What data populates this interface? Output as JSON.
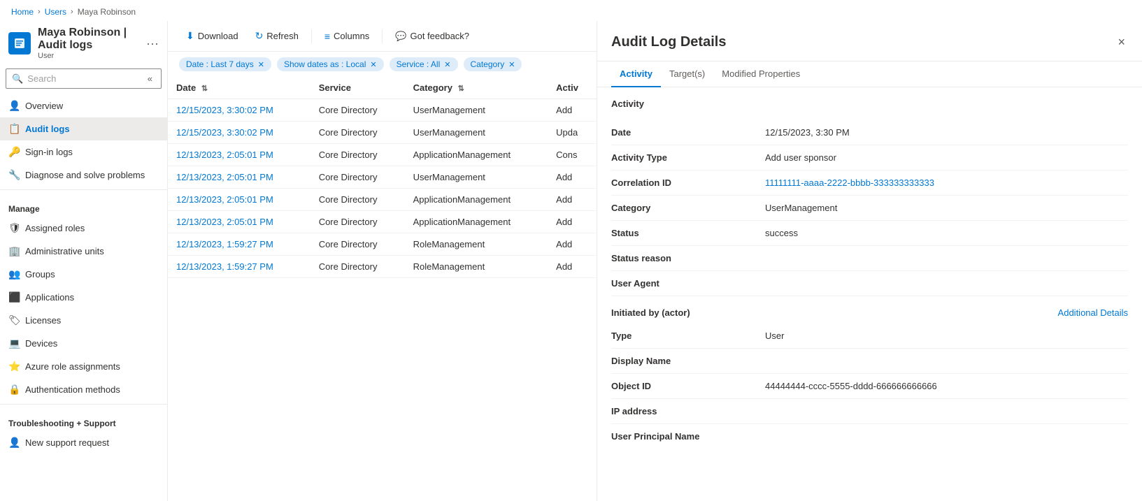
{
  "breadcrumb": {
    "items": [
      "Home",
      "Users",
      "Maya Robinson"
    ],
    "separators": [
      ">",
      ">"
    ]
  },
  "page": {
    "title": "Maya Robinson | Audit logs",
    "subtitle": "User",
    "more_icon": "···"
  },
  "sidebar": {
    "search_placeholder": "Search",
    "collapse_icon": "«",
    "nav_items": [
      {
        "id": "overview",
        "label": "Overview",
        "icon": "👤",
        "active": false
      },
      {
        "id": "audit-logs",
        "label": "Audit logs",
        "icon": "📋",
        "active": true
      },
      {
        "id": "sign-in-logs",
        "label": "Sign-in logs",
        "icon": "🔑",
        "active": false
      },
      {
        "id": "diagnose",
        "label": "Diagnose and solve problems",
        "icon": "🔧",
        "active": false
      }
    ],
    "manage_label": "Manage",
    "manage_items": [
      {
        "id": "assigned-roles",
        "label": "Assigned roles",
        "icon": "🛡"
      },
      {
        "id": "admin-units",
        "label": "Administrative units",
        "icon": "🏢"
      },
      {
        "id": "groups",
        "label": "Groups",
        "icon": "👥"
      },
      {
        "id": "applications",
        "label": "Applications",
        "icon": "⬛"
      },
      {
        "id": "licenses",
        "label": "Licenses",
        "icon": "🏷"
      },
      {
        "id": "devices",
        "label": "Devices",
        "icon": "💻"
      },
      {
        "id": "azure-roles",
        "label": "Azure role assignments",
        "icon": "⭐"
      },
      {
        "id": "auth-methods",
        "label": "Authentication methods",
        "icon": "🔒"
      }
    ],
    "troubleshooting_label": "Troubleshooting + Support",
    "support_items": [
      {
        "id": "new-support",
        "label": "New support request",
        "icon": "👤"
      }
    ]
  },
  "toolbar": {
    "download_label": "Download",
    "refresh_label": "Refresh",
    "columns_label": "Columns",
    "feedback_label": "Got feedback?"
  },
  "filters": {
    "date_filter": "Date : Last 7 days",
    "show_dates_filter": "Show dates as : Local",
    "service_filter": "Service : All",
    "category_filter": "Category"
  },
  "table": {
    "columns": [
      {
        "id": "date",
        "label": "Date",
        "sortable": true
      },
      {
        "id": "service",
        "label": "Service",
        "sortable": false
      },
      {
        "id": "category",
        "label": "Category",
        "sortable": true
      },
      {
        "id": "activity",
        "label": "Activ",
        "sortable": false
      }
    ],
    "rows": [
      {
        "date": "12/15/2023, 3:30:02 PM",
        "service": "Core Directory",
        "category": "UserManagement",
        "activity": "Add"
      },
      {
        "date": "12/15/2023, 3:30:02 PM",
        "service": "Core Directory",
        "category": "UserManagement",
        "activity": "Upda"
      },
      {
        "date": "12/13/2023, 2:05:01 PM",
        "service": "Core Directory",
        "category": "ApplicationManagement",
        "activity": "Cons"
      },
      {
        "date": "12/13/2023, 2:05:01 PM",
        "service": "Core Directory",
        "category": "UserManagement",
        "activity": "Add"
      },
      {
        "date": "12/13/2023, 2:05:01 PM",
        "service": "Core Directory",
        "category": "ApplicationManagement",
        "activity": "Add"
      },
      {
        "date": "12/13/2023, 2:05:01 PM",
        "service": "Core Directory",
        "category": "ApplicationManagement",
        "activity": "Add"
      },
      {
        "date": "12/13/2023, 1:59:27 PM",
        "service": "Core Directory",
        "category": "RoleManagement",
        "activity": "Add"
      },
      {
        "date": "12/13/2023, 1:59:27 PM",
        "service": "Core Directory",
        "category": "RoleManagement",
        "activity": "Add"
      }
    ]
  },
  "detail_panel": {
    "title": "Audit Log Details",
    "close_icon": "×",
    "tabs": [
      {
        "id": "activity",
        "label": "Activity",
        "active": true
      },
      {
        "id": "targets",
        "label": "Target(s)",
        "active": false
      },
      {
        "id": "modified-properties",
        "label": "Modified Properties",
        "active": false
      }
    ],
    "activity_section_title": "Activity",
    "fields": [
      {
        "label": "Date",
        "value": "12/15/2023, 3:30 PM",
        "type": "normal"
      },
      {
        "label": "Activity Type",
        "value": "Add user sponsor",
        "type": "normal"
      },
      {
        "label": "Correlation ID",
        "value": "11111111-aaaa-2222-bbbb-333333333333",
        "type": "link"
      },
      {
        "label": "Category",
        "value": "UserManagement",
        "type": "normal"
      },
      {
        "label": "Status",
        "value": "success",
        "type": "normal"
      },
      {
        "label": "Status reason",
        "value": "",
        "type": "normal"
      },
      {
        "label": "User Agent",
        "value": "",
        "type": "normal"
      }
    ],
    "initiated_by_label": "Initiated by (actor)",
    "additional_details_label": "Additional Details",
    "actor_fields": [
      {
        "label": "Type",
        "value": "User",
        "type": "normal"
      },
      {
        "label": "Display Name",
        "value": "",
        "type": "normal"
      },
      {
        "label": "Object ID",
        "value": "44444444-cccc-5555-dddd-666666666666",
        "type": "normal"
      },
      {
        "label": "IP address",
        "value": "",
        "type": "normal"
      },
      {
        "label": "User Principal Name",
        "value": "",
        "type": "normal"
      }
    ]
  }
}
